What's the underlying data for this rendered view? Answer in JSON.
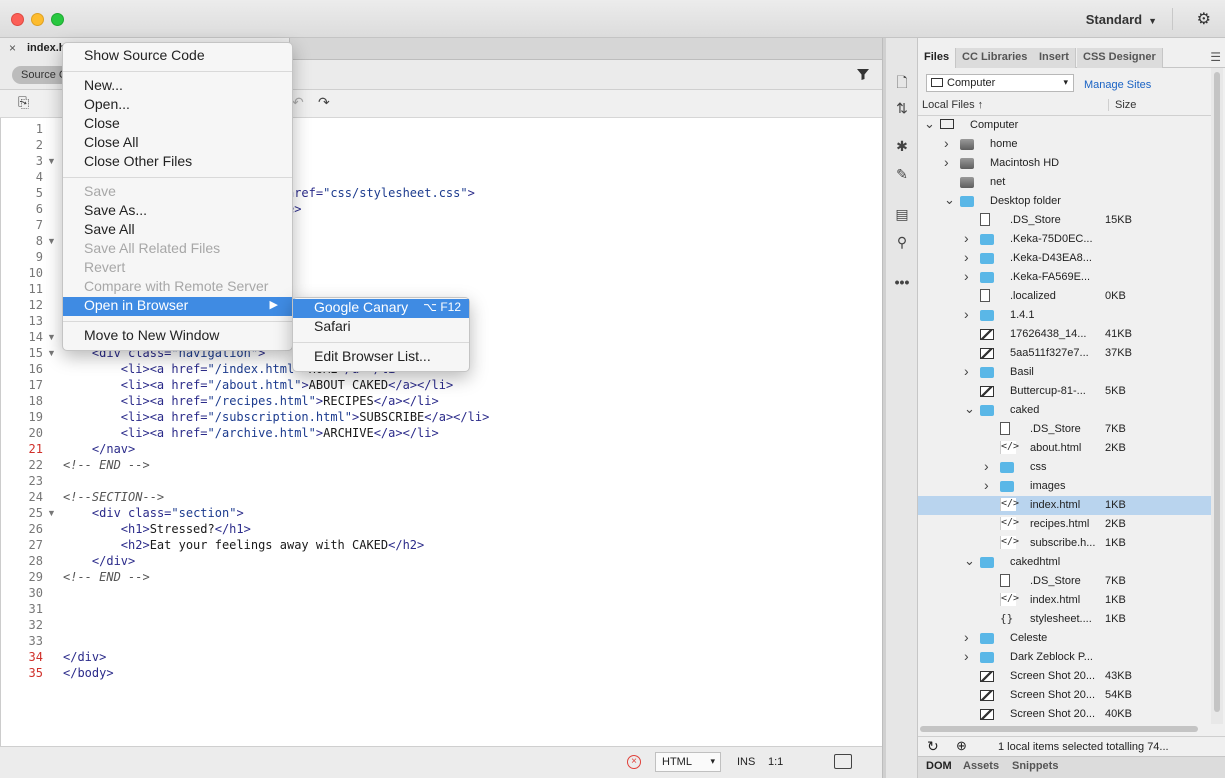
{
  "window": {
    "workspace_label": "Standard",
    "document_tab": "index.h"
  },
  "view": {
    "source_button": "Source C"
  },
  "code": {
    "lines": [
      {
        "n": "1",
        "err": false,
        "fold": false,
        "html": ""
      },
      {
        "n": "2",
        "err": false,
        "fold": false,
        "html": ""
      },
      {
        "n": "3",
        "err": false,
        "fold": true,
        "html": ""
      },
      {
        "n": "4",
        "err": false,
        "fold": false,
        "html": ""
      },
      {
        "n": "5",
        "err": false,
        "fold": false,
        "html": "                      <span class=\"t-attr\">ext/css\"</span> <span class=\"t-attr\">href=</span><span class=\"t-str\">\"css/stylesheet.css\"</span><span class=\"t-tag\">&gt;</span>"
      },
      {
        "n": "6",
        "err": false,
        "fold": false,
        "html": "                      ine<span class=\"t-tag\">&lt;/title&gt;</span>"
      },
      {
        "n": "7",
        "err": false,
        "fold": false,
        "html": ""
      },
      {
        "n": "8",
        "err": false,
        "fold": true,
        "html": ""
      },
      {
        "n": "9",
        "err": false,
        "fold": false,
        "html": ""
      },
      {
        "n": "10",
        "err": false,
        "fold": false,
        "html": ""
      },
      {
        "n": "11",
        "err": false,
        "fold": false,
        "html": "                          <span class=\"t-tag\">iv&gt;</span>"
      },
      {
        "n": "12",
        "err": false,
        "fold": false,
        "html": ""
      },
      {
        "n": "13",
        "err": false,
        "fold": false,
        "html": ""
      },
      {
        "n": "14",
        "err": false,
        "fold": true,
        "html": ""
      },
      {
        "n": "15",
        "err": false,
        "fold": true,
        "html": "    <span class=\"t-tag\">&lt;div</span> <span class=\"t-attr\">class=</span><span class=\"t-str\">\"navigation\"</span><span class=\"t-tag\">&gt;</span>"
      },
      {
        "n": "16",
        "err": false,
        "fold": false,
        "html": "        <span class=\"t-tag\">&lt;li&gt;&lt;a</span> <span class=\"t-attr\">href=</span><span class=\"t-str\">\"/index.html\"</span><span class=\"t-tag\">&gt;</span>HOME<span class=\"t-tag\">&lt;/a&gt;&lt;/li&gt;</span>"
      },
      {
        "n": "17",
        "err": false,
        "fold": false,
        "html": "        <span class=\"t-tag\">&lt;li&gt;&lt;a</span> <span class=\"t-attr\">href=</span><span class=\"t-str\">\"/about.html\"</span><span class=\"t-tag\">&gt;</span>ABOUT CAKED<span class=\"t-tag\">&lt;/a&gt;&lt;/li&gt;</span>"
      },
      {
        "n": "18",
        "err": false,
        "fold": false,
        "html": "        <span class=\"t-tag\">&lt;li&gt;&lt;a</span> <span class=\"t-attr\">href=</span><span class=\"t-str\">\"/recipes.html\"</span><span class=\"t-tag\">&gt;</span>RECIPES<span class=\"t-tag\">&lt;/a&gt;&lt;/li&gt;</span>"
      },
      {
        "n": "19",
        "err": false,
        "fold": false,
        "html": "        <span class=\"t-tag\">&lt;li&gt;&lt;a</span> <span class=\"t-attr\">href=</span><span class=\"t-str\">\"/subscription.html\"</span><span class=\"t-tag\">&gt;</span>SUBSCRIBE<span class=\"t-tag\">&lt;/a&gt;&lt;/li&gt;</span>"
      },
      {
        "n": "20",
        "err": false,
        "fold": false,
        "html": "        <span class=\"t-tag\">&lt;li&gt;&lt;a</span> <span class=\"t-attr\">href=</span><span class=\"t-str\">\"/archive.html\"</span><span class=\"t-tag\">&gt;</span>ARCHIVE<span class=\"t-tag\">&lt;/a&gt;&lt;/li&gt;</span>"
      },
      {
        "n": "21",
        "err": true,
        "fold": false,
        "html": "    <span class=\"t-tag\">&lt;/nav&gt;</span>"
      },
      {
        "n": "22",
        "err": false,
        "fold": false,
        "html": "<span class=\"t-com\">&lt;!-- END --&gt;</span>"
      },
      {
        "n": "23",
        "err": false,
        "fold": false,
        "html": ""
      },
      {
        "n": "24",
        "err": false,
        "fold": false,
        "html": "<span class=\"t-com\">&lt;!--SECTION--&gt;</span>"
      },
      {
        "n": "25",
        "err": false,
        "fold": true,
        "html": "    <span class=\"t-tag\">&lt;div</span> <span class=\"t-attr\">class=</span><span class=\"t-str\">\"section\"</span><span class=\"t-tag\">&gt;</span>"
      },
      {
        "n": "26",
        "err": false,
        "fold": false,
        "html": "        <span class=\"t-tag\">&lt;h1&gt;</span>Stressed?<span class=\"t-tag\">&lt;/h1&gt;</span>"
      },
      {
        "n": "27",
        "err": false,
        "fold": false,
        "html": "        <span class=\"t-tag\">&lt;h2&gt;</span>Eat your feelings away with CAKED<span class=\"t-tag\">&lt;/h2&gt;</span>"
      },
      {
        "n": "28",
        "err": false,
        "fold": false,
        "html": "    <span class=\"t-tag\">&lt;/div&gt;</span>"
      },
      {
        "n": "29",
        "err": false,
        "fold": false,
        "html": "<span class=\"t-com\">&lt;!-- END --&gt;</span>"
      },
      {
        "n": "30",
        "err": false,
        "fold": false,
        "html": ""
      },
      {
        "n": "31",
        "err": false,
        "fold": false,
        "html": ""
      },
      {
        "n": "32",
        "err": false,
        "fold": false,
        "html": ""
      },
      {
        "n": "33",
        "err": false,
        "fold": false,
        "html": ""
      },
      {
        "n": "34",
        "err": true,
        "fold": false,
        "html": "<span class=\"t-tag\">&lt;/div&gt;</span>"
      },
      {
        "n": "35",
        "err": true,
        "fold": false,
        "html": "<span class=\"t-tag\">&lt;/body&gt;</span>"
      }
    ]
  },
  "statusbar": {
    "language": "HTML",
    "mode": "INS",
    "cursor": "1:1"
  },
  "context_menu": {
    "items": [
      {
        "label": "Show Source Code",
        "disabled": false
      },
      {
        "sep": true
      },
      {
        "label": "New...",
        "disabled": false
      },
      {
        "label": "Open...",
        "disabled": false
      },
      {
        "label": "Close",
        "disabled": false
      },
      {
        "label": "Close All",
        "disabled": false
      },
      {
        "label": "Close Other Files",
        "disabled": false
      },
      {
        "sep": true
      },
      {
        "label": "Save",
        "disabled": true
      },
      {
        "label": "Save As...",
        "disabled": false
      },
      {
        "label": "Save All",
        "disabled": false
      },
      {
        "label": "Save All Related Files",
        "disabled": true
      },
      {
        "label": "Revert",
        "disabled": true
      },
      {
        "label": "Compare with Remote Server",
        "disabled": true
      },
      {
        "label": "Open in Browser",
        "disabled": false,
        "highlighted": true,
        "submenu": true
      },
      {
        "sep": true
      },
      {
        "label": "Move to New Window",
        "disabled": false
      }
    ]
  },
  "browser_submenu": {
    "items": [
      {
        "label": "Google Canary",
        "shortcut": "⌥ F12",
        "highlighted": true
      },
      {
        "label": "Safari"
      },
      {
        "sep": true
      },
      {
        "label": "Edit Browser List..."
      }
    ]
  },
  "files_panel": {
    "tabs": [
      "Files",
      "CC Libraries",
      "Insert",
      "CSS Designer"
    ],
    "active_tab": "Files",
    "site": "Computer",
    "manage_sites": "Manage Sites",
    "col_local": "Local Files ↑",
    "col_size": "Size",
    "tree": [
      {
        "name": "Computer",
        "icon": "monitor",
        "level": 0,
        "arrow": "open",
        "size": ""
      },
      {
        "name": "home",
        "icon": "disk",
        "level": 1,
        "arrow": "closed",
        "size": ""
      },
      {
        "name": "Macintosh HD",
        "icon": "disk",
        "level": 1,
        "arrow": "closed",
        "size": ""
      },
      {
        "name": "net",
        "icon": "disk",
        "level": 1,
        "arrow": "",
        "size": ""
      },
      {
        "name": "Desktop folder",
        "icon": "folder",
        "level": 1,
        "arrow": "open",
        "size": ""
      },
      {
        "name": ".DS_Store",
        "icon": "file",
        "level": 2,
        "arrow": "",
        "size": "15KB"
      },
      {
        "name": ".Keka-75D0EC...",
        "icon": "folder",
        "level": 2,
        "arrow": "closed",
        "size": ""
      },
      {
        "name": ".Keka-D43EA8...",
        "icon": "folder",
        "level": 2,
        "arrow": "closed",
        "size": ""
      },
      {
        "name": ".Keka-FA569E...",
        "icon": "folder",
        "level": 2,
        "arrow": "closed",
        "size": ""
      },
      {
        "name": ".localized",
        "icon": "file",
        "level": 2,
        "arrow": "",
        "size": "0KB"
      },
      {
        "name": "1.4.1",
        "icon": "folder",
        "level": 2,
        "arrow": "closed",
        "size": ""
      },
      {
        "name": "17626438_14...",
        "icon": "img",
        "level": 2,
        "arrow": "",
        "size": "41KB"
      },
      {
        "name": "5aa511f327e7...",
        "icon": "img",
        "level": 2,
        "arrow": "",
        "size": "37KB"
      },
      {
        "name": "Basil",
        "icon": "folder",
        "level": 2,
        "arrow": "closed",
        "size": ""
      },
      {
        "name": "Buttercup-81-...",
        "icon": "img",
        "level": 2,
        "arrow": "",
        "size": "5KB"
      },
      {
        "name": "caked",
        "icon": "folder",
        "level": 2,
        "arrow": "open",
        "size": ""
      },
      {
        "name": ".DS_Store",
        "icon": "file",
        "level": 3,
        "arrow": "",
        "size": "7KB"
      },
      {
        "name": "about.html",
        "icon": "code",
        "level": 3,
        "arrow": "",
        "size": "2KB"
      },
      {
        "name": "css",
        "icon": "folder",
        "level": 3,
        "arrow": "closed",
        "size": ""
      },
      {
        "name": "images",
        "icon": "folder",
        "level": 3,
        "arrow": "closed",
        "size": ""
      },
      {
        "name": "index.html",
        "icon": "code",
        "level": 3,
        "arrow": "",
        "size": "1KB",
        "selected": true
      },
      {
        "name": "recipes.html",
        "icon": "code",
        "level": 3,
        "arrow": "",
        "size": "2KB"
      },
      {
        "name": "subscribe.h...",
        "icon": "code",
        "level": 3,
        "arrow": "",
        "size": "1KB"
      },
      {
        "name": "cakedhtml",
        "icon": "folder",
        "level": 2,
        "arrow": "open",
        "size": ""
      },
      {
        "name": ".DS_Store",
        "icon": "file",
        "level": 3,
        "arrow": "",
        "size": "7KB"
      },
      {
        "name": "index.html",
        "icon": "code",
        "level": 3,
        "arrow": "",
        "size": "1KB"
      },
      {
        "name": "stylesheet....",
        "icon": "css",
        "level": 3,
        "arrow": "",
        "size": "1KB"
      },
      {
        "name": "Celeste",
        "icon": "folder",
        "level": 2,
        "arrow": "closed",
        "size": ""
      },
      {
        "name": "Dark Zeblock P...",
        "icon": "folder",
        "level": 2,
        "arrow": "closed",
        "size": ""
      },
      {
        "name": "Screen Shot 20...",
        "icon": "img",
        "level": 2,
        "arrow": "",
        "size": "43KB"
      },
      {
        "name": "Screen Shot 20...",
        "icon": "img",
        "level": 2,
        "arrow": "",
        "size": "54KB"
      },
      {
        "name": "Screen Shot 20...",
        "icon": "img",
        "level": 2,
        "arrow": "",
        "size": "40KB"
      }
    ],
    "status": "1 local items selected totalling 74...",
    "bottom_tabs": [
      "DOM",
      "Assets",
      "Snippets"
    ],
    "active_bottom_tab": "DOM"
  }
}
